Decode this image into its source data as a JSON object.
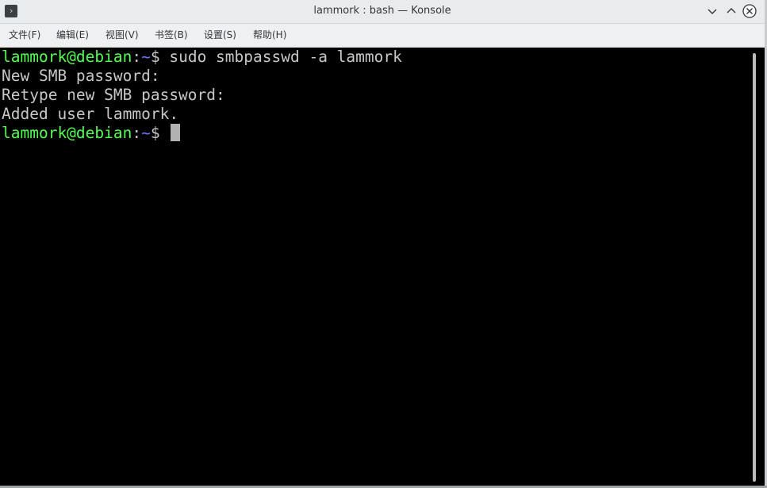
{
  "window": {
    "title": "lammork : bash — Konsole",
    "app_icon": "terminal-icon",
    "controls": [
      "minimize-icon",
      "maximize-icon",
      "close-icon"
    ]
  },
  "menu": {
    "items": [
      {
        "label": "文件(F)"
      },
      {
        "label": "编辑(E)"
      },
      {
        "label": "视图(V)"
      },
      {
        "label": "书签(B)"
      },
      {
        "label": "设置(S)"
      },
      {
        "label": "帮助(H)"
      }
    ]
  },
  "terminal": {
    "colors": {
      "user_host": "#54ff54",
      "path": "#6e6eff",
      "text": "#c7c7c7",
      "background": "#000000"
    },
    "lines": [
      {
        "user_host": "lammork@debian",
        "sep": ":",
        "path": "~",
        "prompt": "$ ",
        "command": "sudo smbpasswd -a lammork"
      },
      {
        "text": "New SMB password:"
      },
      {
        "text": "Retype new SMB password:"
      },
      {
        "text": "Added user lammork."
      },
      {
        "user_host": "lammork@debian",
        "sep": ":",
        "path": "~",
        "prompt": "$ ",
        "command": ""
      }
    ]
  }
}
